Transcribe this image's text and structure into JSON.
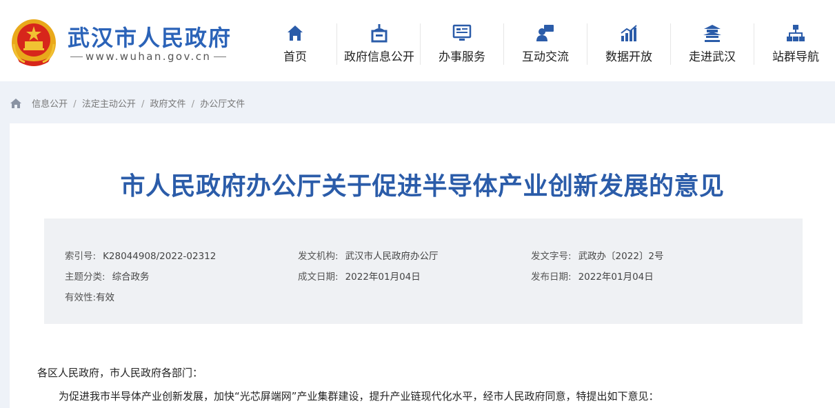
{
  "site": {
    "name": "武汉市人民政府",
    "url": "www.wuhan.gov.cn"
  },
  "nav": {
    "items": [
      {
        "label": "首页",
        "icon": "home-icon"
      },
      {
        "label": "政府信息公开",
        "icon": "building-icon"
      },
      {
        "label": "办事服务",
        "icon": "monitor-icon"
      },
      {
        "label": "互动交流",
        "icon": "chat-user-icon"
      },
      {
        "label": "数据开放",
        "icon": "bar-chart-icon"
      },
      {
        "label": "走进武汉",
        "icon": "pavilion-icon"
      },
      {
        "label": "站群导航",
        "icon": "sitemap-icon"
      }
    ]
  },
  "breadcrumb": {
    "items": [
      "信息公开",
      "法定主动公开",
      "政府文件",
      "办公厅文件"
    ],
    "separator": "/"
  },
  "article": {
    "title": "市人民政府办公厅关于促进半导体产业创新发展的意见",
    "meta": {
      "index_label": "索引号:",
      "index_value": "K28044908/2022-02312",
      "issuer_label": "发文机构:",
      "issuer_value": "武汉市人民政府办公厅",
      "doc_no_label": "发文字号:",
      "doc_no_value": "武政办〔2022〕2号",
      "topic_label": "主题分类:",
      "topic_value": "综合政务",
      "written_label": "成文日期:",
      "written_value": "2022年01月04日",
      "published_label": "发布日期:",
      "published_value": "2022年01月04日",
      "validity_label": "有效性:",
      "validity_value": "有效"
    },
    "salutation": "各区人民政府，市人民政府各部门：",
    "intro": "为促进我市半导体产业创新发展，加快“光芯屏端网”产业集群建设，提升产业链现代化水平，经市人民政府同意，特提出如下意见："
  },
  "colors": {
    "brand_blue": "#2b63b8",
    "title_blue": "#2b5ca9",
    "emblem_red": "#d7261b",
    "emblem_gold": "#f1c232",
    "nav_icon_blue": "#2b5ca9"
  }
}
